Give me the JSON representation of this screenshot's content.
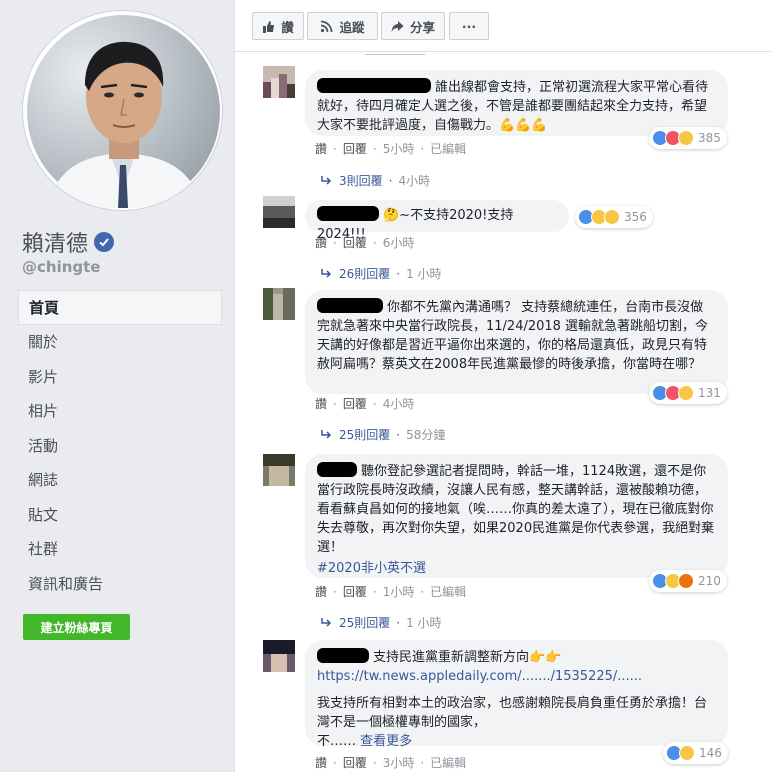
{
  "profile": {
    "name": "賴清德",
    "handle": "@chingte"
  },
  "nav": [
    "首頁",
    "關於",
    "影片",
    "相片",
    "活動",
    "網誌",
    "貼文",
    "社群",
    "資訊和廣告"
  ],
  "create_page_label": "建立粉絲專頁",
  "toolbar": {
    "like_label": "讚",
    "follow_label": "追蹤",
    "share_label": "分享",
    "more_label": "···"
  },
  "comments": [
    {
      "text": "誰出線都會支持，正常初選流程大家平常心看待就好，待四月確定人選之後，不管是誰都要團結起來全力支持，希望大家不要批評過度，自傷戰力。💪💪💪",
      "reaction_count": "385",
      "like": "讚",
      "reply": "回覆",
      "time": "5小時",
      "edited": "已編輯",
      "replies": "3則回覆",
      "replies_time": "4小時"
    },
    {
      "text": "🤔~不支持2020!支持2024!!!",
      "reaction_count": "356",
      "like": "讚",
      "reply": "回覆",
      "time": "6小時",
      "replies": "26則回覆",
      "replies_time": "1 小時"
    },
    {
      "text": "你都不先黨內溝通嗎？ 支持蔡總統連任，台南市長沒做完就急著來中央當行政院長，11/24/2018 選輸就急著跳船切割，今天講的好像都是習近平逼你出來選的，你的格局還真低，政見只有特赦阿扁嗎？蔡英文在2008年民進黨最慘的時後承擔，你當時在哪？",
      "reaction_count": "131",
      "like": "讚",
      "reply": "回覆",
      "time": "4小時",
      "replies": "25則回覆",
      "replies_time": "58分鐘"
    },
    {
      "text": "聽你登記參選記者提問時，幹話一堆，1124敗選，還不是你當行政院長時沒政績，沒讓人民有感，整天講幹話，還被酸賴功德，看看蘇貞昌如何的接地氣（唉……你真的差太遠了），現在已徹底對你失去尊敬，再次對你失望，如果2020民進黨是你代表參選，我絕對棄選！",
      "hashtag": "#2020非小英不選",
      "reaction_count": "210",
      "like": "讚",
      "reply": "回覆",
      "time": "1小時",
      "edited": "已編輯",
      "replies": "25則回覆",
      "replies_time": "1 小時"
    },
    {
      "text": "支持民進黨重新調整新方向👉👉",
      "url": "https://tw.news.appledaily.com/......./1535225/......",
      "body": "我支持所有相對本土的政治家，也感謝賴院長肩負重任勇於承擔！台灣不是一個極權專制的國家，",
      "ellipsis": "不……",
      "see_more": "查看更多",
      "reaction_count": "146",
      "like": "讚",
      "reply": "回覆",
      "time": "3小時",
      "edited": "已編輯"
    }
  ],
  "colors": {
    "accent": "#4267b2",
    "link": "#385898",
    "green_button": "#42b72a",
    "bubble": "#f2f3f5"
  }
}
